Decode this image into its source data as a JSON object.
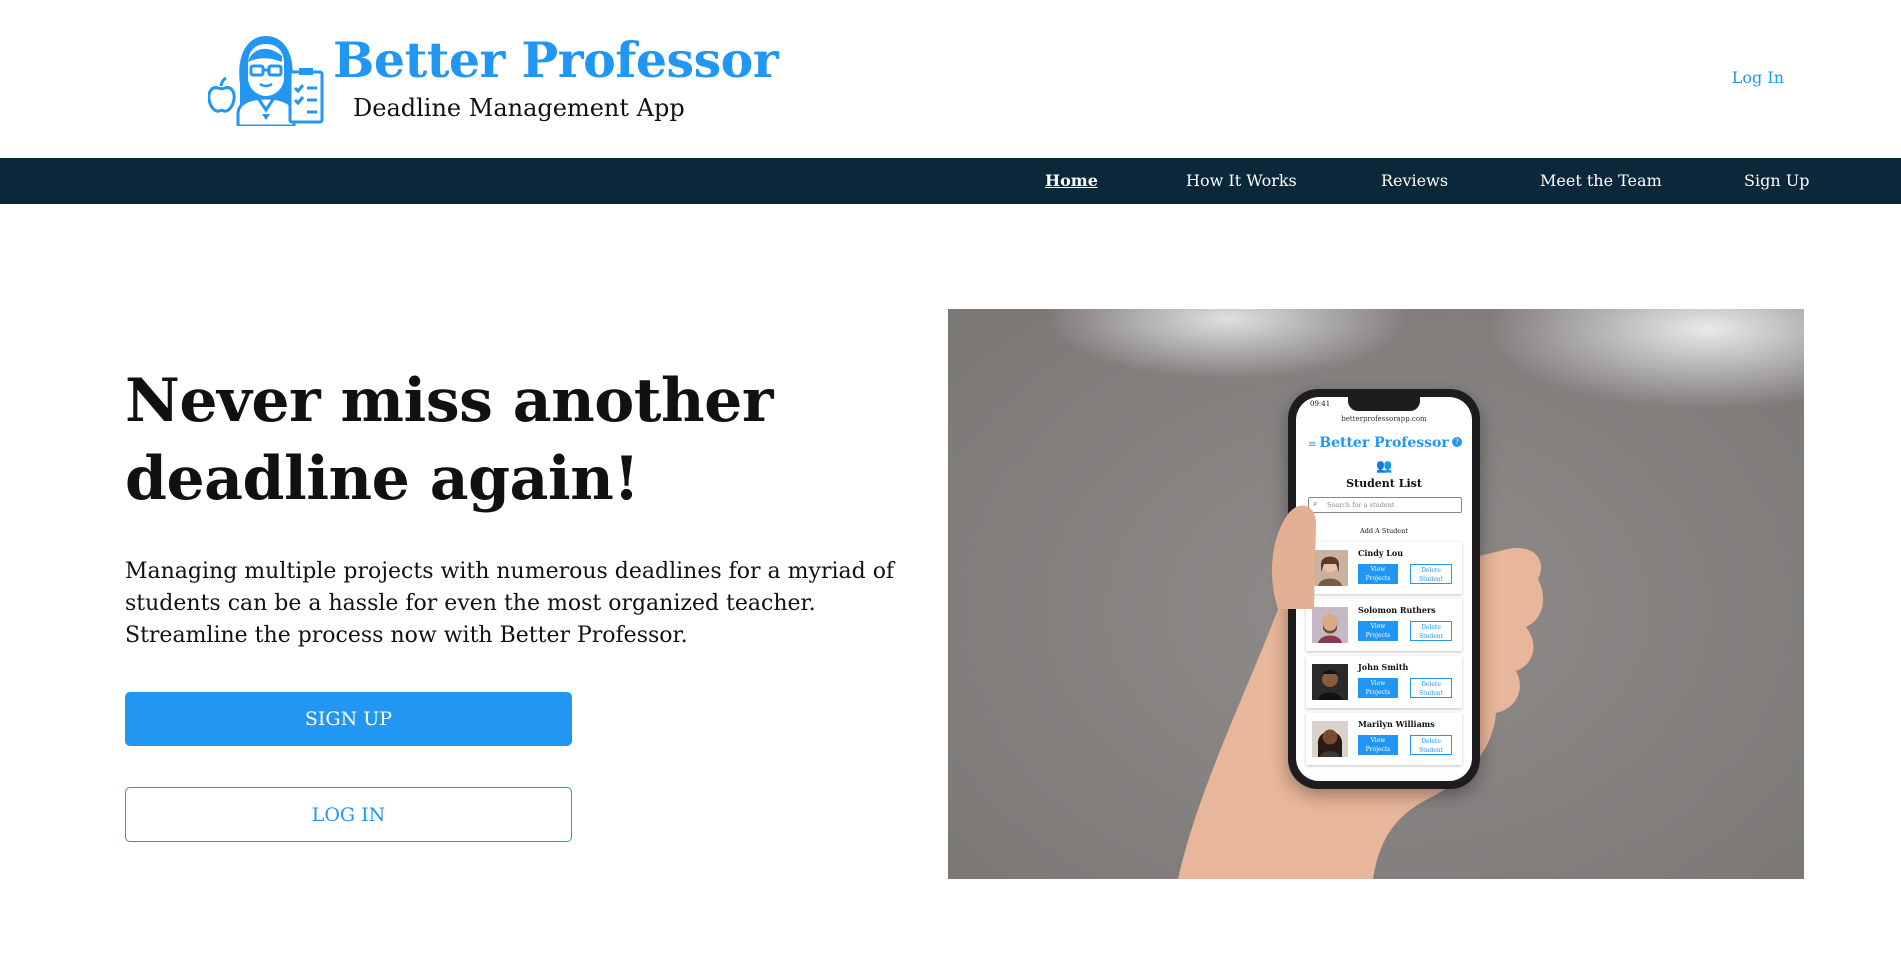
{
  "header": {
    "brand_title": "Better Professor",
    "brand_subtitle": "Deadline Management App",
    "login_link": "Log In"
  },
  "nav": {
    "items": [
      {
        "label": "Home",
        "active": true
      },
      {
        "label": "How It Works"
      },
      {
        "label": "Reviews"
      },
      {
        "label": "Meet the Team"
      },
      {
        "label": "Sign Up"
      }
    ]
  },
  "hero": {
    "title": "Never miss another deadline again!",
    "text": "Managing multiple projects with numerous deadlines for a myriad of students can be a hassle for even the most organized teacher. Streamline the process now with Better Professor.",
    "signup_button": "SIGN UP",
    "login_button": "LOG IN"
  },
  "phone_screen": {
    "time": "09:41",
    "url": "betterprofessorapp.com",
    "brand": "Better Professor",
    "heading": "Student List",
    "search_placeholder": "Search for a student",
    "add_student": "Add A Student",
    "view_label": "View Projects",
    "delete_label": "Delete Student",
    "students": [
      "Cindy Lou",
      "Solomon Ruthers",
      "John Smith",
      "Marilyn Williams"
    ]
  },
  "colors": {
    "brand_blue": "#2196f3",
    "nav_background": "#0a2839",
    "text": "#111111"
  }
}
